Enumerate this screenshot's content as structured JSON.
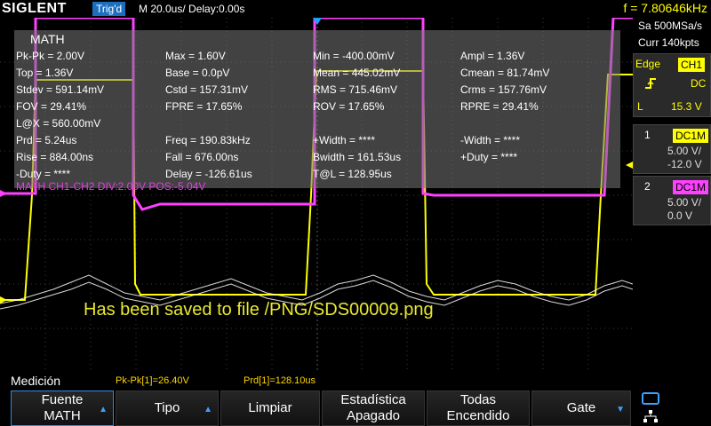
{
  "topbar": {
    "brand": "SIGLENT",
    "trigger_status": "Trig'd",
    "timebase": "M 20.0us/  Delay:0.00s",
    "frequency": "f = 7.80646kHz"
  },
  "measure_panel": {
    "title": "MATH",
    "rows": [
      [
        "Pk-Pk = 2.00V",
        "Max = 1.60V",
        "Min = -400.00mV",
        "Ampl = 1.36V"
      ],
      [
        "Top = 1.36V",
        "Base = 0.0pV",
        "Mean = 445.02mV",
        "Cmean = 81.74mV"
      ],
      [
        "Stdev = 591.14mV",
        "Cstd = 157.31mV",
        "RMS = 715.46mV",
        "Crms = 157.76mV"
      ],
      [
        "FOV = 29.41%",
        "FPRE = 17.65%",
        "ROV = 17.65%",
        "RPRE = 29.41%"
      ],
      [
        "L@X = 560.00mV",
        "",
        "",
        ""
      ],
      [
        "Prd = 5.24us",
        "Freq = 190.83kHz",
        "+Width = ****",
        "-Width = ****"
      ],
      [
        "Rise = 884.00ns",
        "Fall = 676.00ns",
        "Bwidth = 161.53us",
        "+Duty = ****"
      ],
      [
        "-Duty = ****",
        "Delay = -126.61us",
        "T@L = 128.95us",
        ""
      ]
    ]
  },
  "math_status": "MATH  CH1-CH2  DIV:2.00V  POS:-5.04V",
  "save_message": "Has been saved to file /PNG/SDS00009.png",
  "right_panel": {
    "sample_rate": "Sa 500MSa/s",
    "memory_depth": "Curr 140kpts",
    "trigger": {
      "type": "Edge",
      "source": "CH1",
      "coupling": "DC",
      "slope_icon": "rising-edge-icon",
      "level_label": "L",
      "level": "15.3 V"
    },
    "ch1": {
      "number": "1",
      "coupling": "DC1M",
      "scale": "5.00 V/",
      "offset": "-12.0 V"
    },
    "ch2": {
      "number": "2",
      "coupling": "DC1M",
      "scale": "5.00 V/",
      "offset": "0.0 V"
    }
  },
  "bottom": {
    "menu_title": "Medición",
    "readouts": [
      "Pk-Pk[1]=26.40V",
      "Prd[1]=128.10us"
    ],
    "softkeys": [
      {
        "line1": "Fuente",
        "line2": "MATH",
        "arrow": "▲"
      },
      {
        "line1": "Tipo",
        "line2": "",
        "arrow": "▲"
      },
      {
        "line1": "Limpiar",
        "line2": "",
        "arrow": ""
      },
      {
        "line1": "Estadística",
        "line2": "Apagado",
        "arrow": ""
      },
      {
        "line1": "Todas",
        "line2": "Encendido",
        "arrow": ""
      },
      {
        "line1": "Gate",
        "line2": "",
        "arrow": "▼"
      }
    ]
  },
  "colors": {
    "ch1": "#ffff00",
    "ch2": "#ff40ff",
    "math": "#ffffff",
    "trigger_badge": "#1c6fbf"
  }
}
